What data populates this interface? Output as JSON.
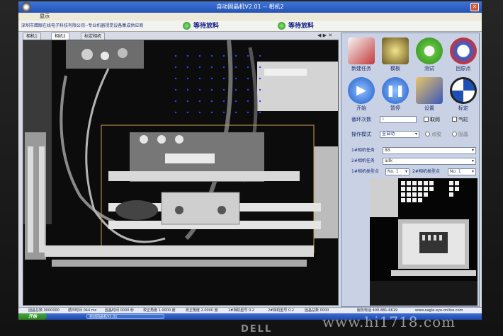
{
  "window": {
    "title": "自动固晶机V2.01 -- 相机2"
  },
  "menu": {
    "label": "显示"
  },
  "banner": {
    "company": "深圳市鹰眼在线电子科技有限公司--专业机器视觉设备集成供应商"
  },
  "status_lamps": [
    {
      "label": "等待放料"
    },
    {
      "label": "等待放料"
    }
  ],
  "tabs": [
    {
      "label": "相机1"
    },
    {
      "label": "相机2"
    },
    {
      "label": "标定相机"
    }
  ],
  "tab_controls": "◀ ▶ ✕",
  "buttons": [
    {
      "label": "新建任务",
      "icon": "new-task-icon"
    },
    {
      "label": "模板",
      "icon": "template-icon"
    },
    {
      "label": "测试",
      "icon": "test-gear-icon"
    },
    {
      "label": "回原点",
      "icon": "home-icon"
    },
    {
      "label": "开始",
      "icon": "play-icon"
    },
    {
      "label": "暂停",
      "icon": "pause-icon"
    },
    {
      "label": "设置",
      "icon": "settings-icon"
    },
    {
      "label": "标定",
      "icon": "calibrate-icon"
    }
  ],
  "controls": {
    "loop_label": "循环次数",
    "loop_value": "1",
    "check_a": "取阅",
    "check_b": "气缸",
    "mode_label": "操作模式",
    "mode_value": "全自动",
    "radio_a": "点胶",
    "radio_b": "固晶",
    "cam1_task_label": "1#相机任务",
    "cam1_task_value": "88",
    "cam2_task_label": "2#相机任务",
    "cam2_task_value": "adk",
    "cam1_type_label": "1#相机类型点",
    "cam1_type_value": "No. 1",
    "cam2_type_label": "2#相机类型点",
    "cam2_type_value": "No. 1"
  },
  "statusbar": [
    "固晶总数 0000000",
    "循环时间 044 ms",
    "固晶时间 0000 秒",
    "校正角度 1.0000 度",
    "校正角度 2.0000 度",
    "1#相机型号 0.2",
    "2#相机型号 0.2",
    "固晶总数 0000",
    "服务电话 400-881-6619"
  ],
  "taskbar": {
    "start": "开始",
    "item": "自动固晶机V2.01"
  },
  "website": "www.eagle-eye-online.com",
  "watermark": "www.hi1718.com",
  "monitor_brand": "DELL",
  "colors": {
    "title_blue": "#2553b4",
    "lamp_green": "#1d8d1a",
    "panel_bg": "#c9d2e4",
    "label_blue": "#1a2a70"
  }
}
